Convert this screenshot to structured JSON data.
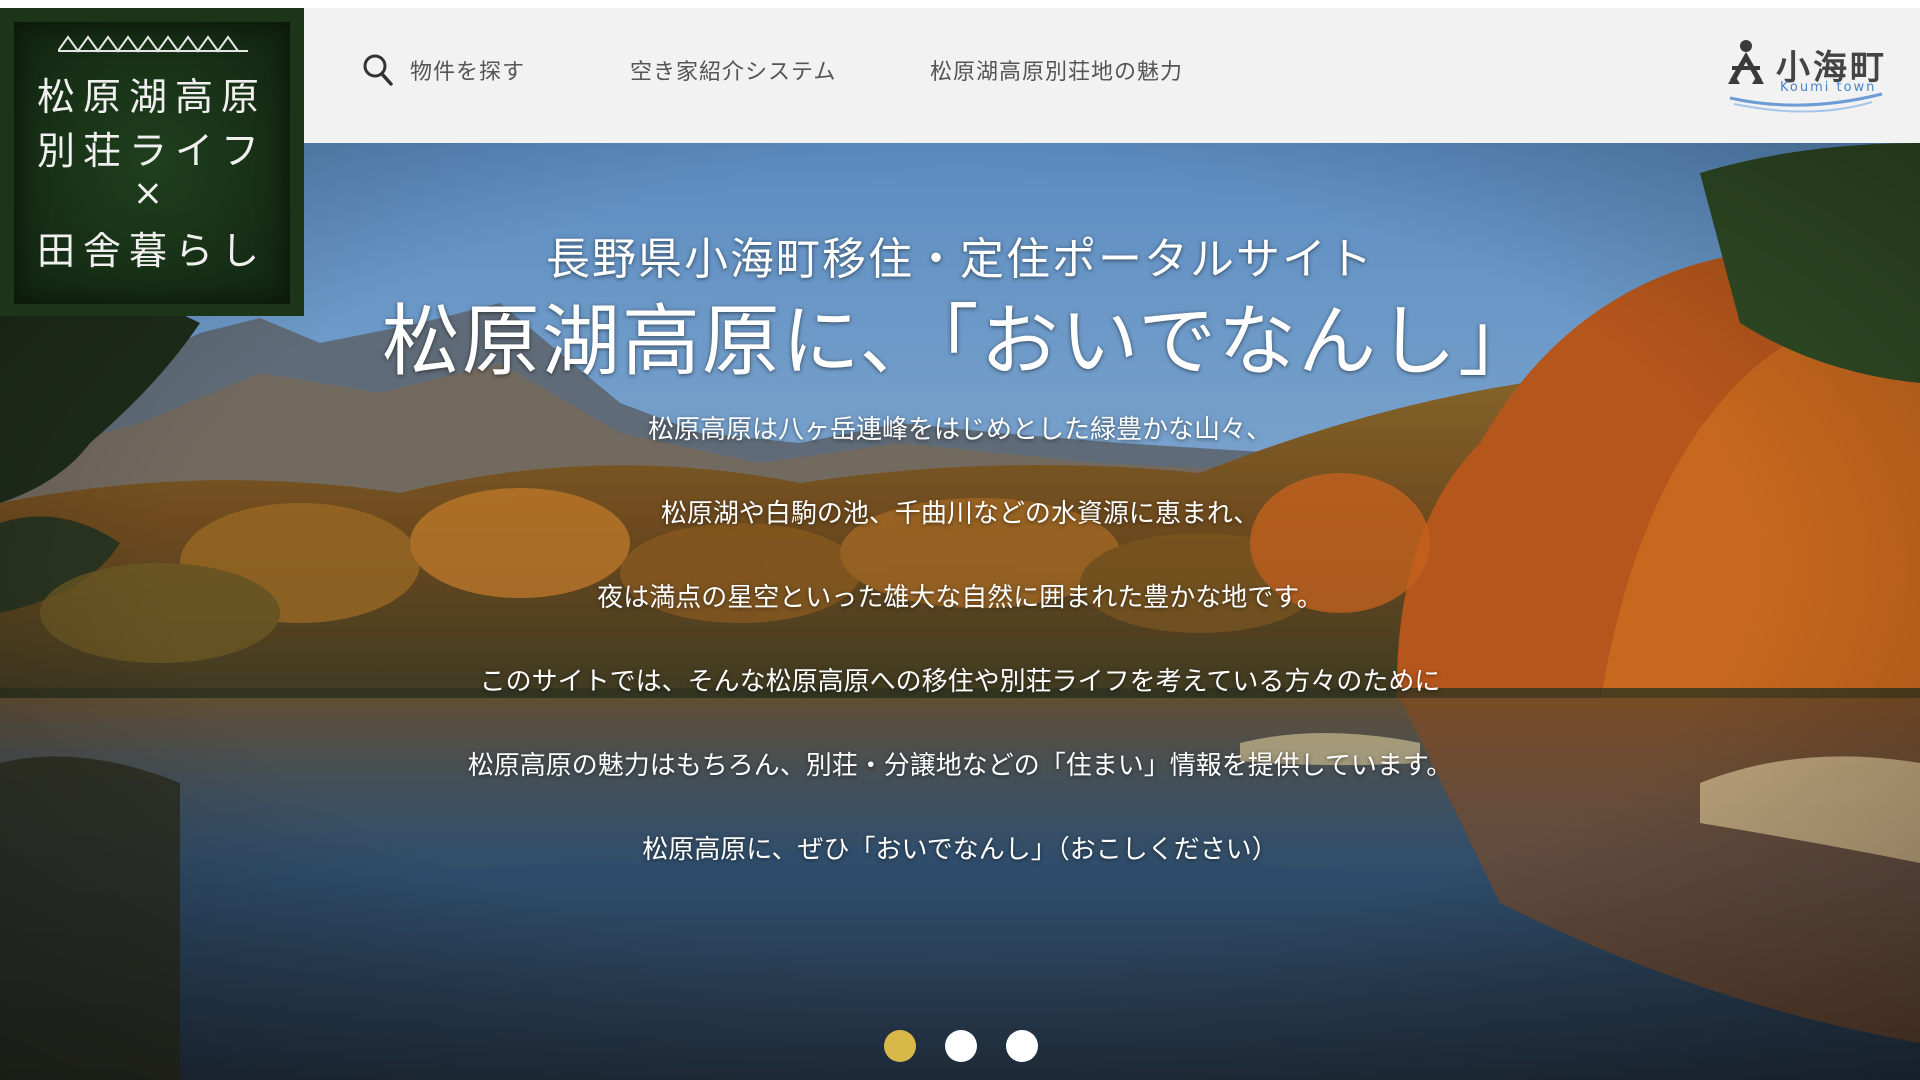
{
  "badge": {
    "line1": "松原湖高原",
    "line2": "別荘ライフ",
    "line3": "×",
    "line4": "田舎暮らし"
  },
  "nav": {
    "items": [
      {
        "label": "物件を探す",
        "icon": "search-icon"
      },
      {
        "label": "空き家紹介システム"
      },
      {
        "label": "松原湖高原別荘地の魅力"
      }
    ]
  },
  "logo": {
    "text": "小海町",
    "sub": "Koumi town"
  },
  "hero": {
    "subtitle": "長野県小海町移住・定住ポータルサイト",
    "title": "松原湖高原に、「おいでなんし」",
    "lines": [
      "松原高原は八ヶ岳連峰をはじめとした緑豊かな山々、",
      "松原湖や白駒の池、千曲川などの水資源に恵まれ、",
      "夜は満点の星空といった雄大な自然に囲まれた豊かな地です。",
      "このサイトでは、そんな松原高原への移住や別荘ライフを考えている方々のために",
      "松原高原の魅力はもちろん、別荘・分譲地などの「住まい」情報を提供しています。",
      "松原高原に、ぜひ「おいでなんし」（おこしください）"
    ]
  },
  "slider": {
    "count": 3,
    "active_index": 0,
    "active_color": "#d9b84a",
    "inactive_color": "#ffffff"
  },
  "colors": {
    "header_bg": "#f2f2f2",
    "badge_bg": "#1c3519",
    "nav_text": "#555555",
    "logo_accent": "#4a84c9"
  }
}
